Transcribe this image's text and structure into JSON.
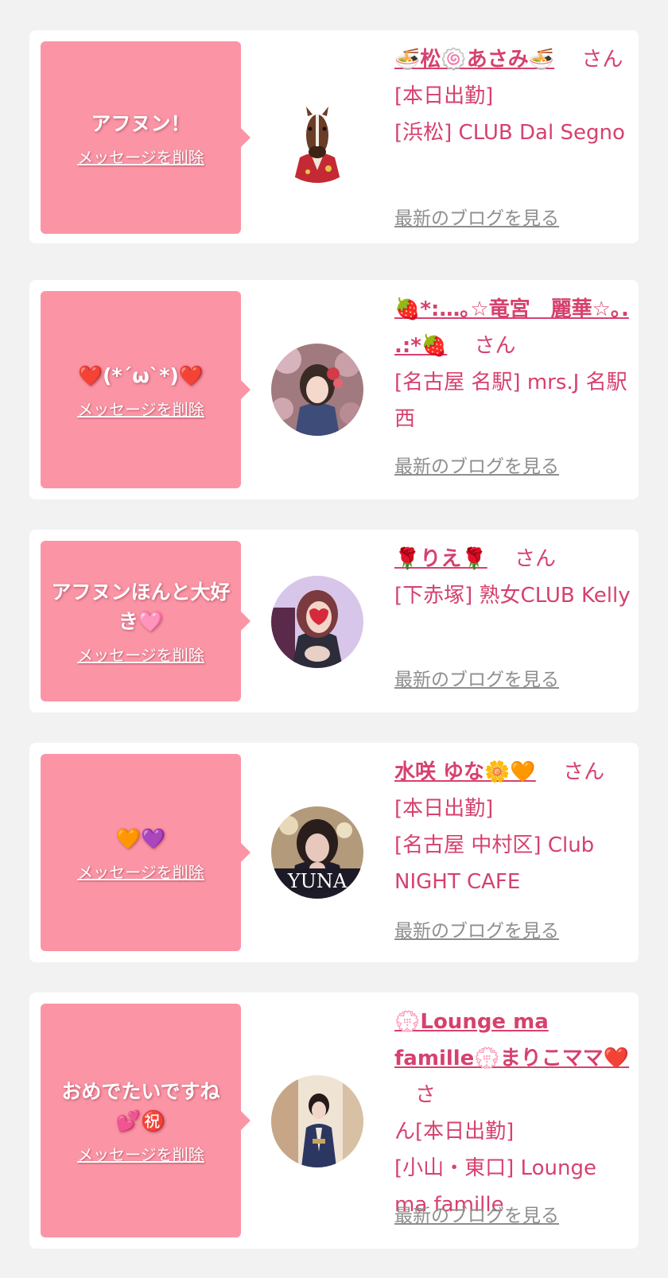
{
  "entries": [
    {
      "message": "アフヌン！",
      "delete_label": "メッセージを削除",
      "name": "🍜松🍥あさみ🍜",
      "honorific": "さん",
      "status": "[本日出勤]",
      "shop": "[浜松] CLUB Dal Segno",
      "blog_label": "最新のブログを見る",
      "avatar": "horse-mask-kimono"
    },
    {
      "message": "❤️(*´ω`*)❤️",
      "delete_label": "メッセージを削除",
      "name": "🍓*:…｡☆竜宮　麗華☆｡. .:*🍓",
      "honorific": "さん",
      "status": "",
      "shop": "[名古屋 名駅] mrs.J 名駅西",
      "blog_label": "最新のブログを見る",
      "avatar": "kimono-woman"
    },
    {
      "message": "アフヌンほんと大好き🩷",
      "delete_label": "メッセージを削除",
      "name": "🌹りえ🌹",
      "honorific": "さん",
      "status": "",
      "shop": "[下赤塚] 熟女CLUB Kelly",
      "blog_label": "最新のブログを見る",
      "avatar": "woman-heart-mask"
    },
    {
      "message": "🧡💜",
      "delete_label": "メッセージを削除",
      "name": "水咲 ゆな🌼🧡",
      "honorific": "さん",
      "status": "[本日出勤]",
      "shop": "[名古屋 中村区] Club NIGHT CAFE",
      "blog_label": "最新のブログを見る",
      "avatar": "yuna-photo",
      "avatar_caption": "YUNA"
    },
    {
      "message": "おめでたいですね💕㊗️",
      "delete_label": "メッセージを削除",
      "name": "💮Lounge ma famille💮まりこママ❤️",
      "honorific": "さ",
      "status": "ん[本日出勤]",
      "shop": "[小山・東口] Lounge ma famille",
      "blog_label": "最新のブログを見る",
      "avatar": "woman-kimono-doorway"
    }
  ],
  "colors": {
    "bubble": "#fb95a5",
    "name_text": "#d6416e",
    "blog_link": "#8e8e8e",
    "background": "#f2f2f2"
  }
}
